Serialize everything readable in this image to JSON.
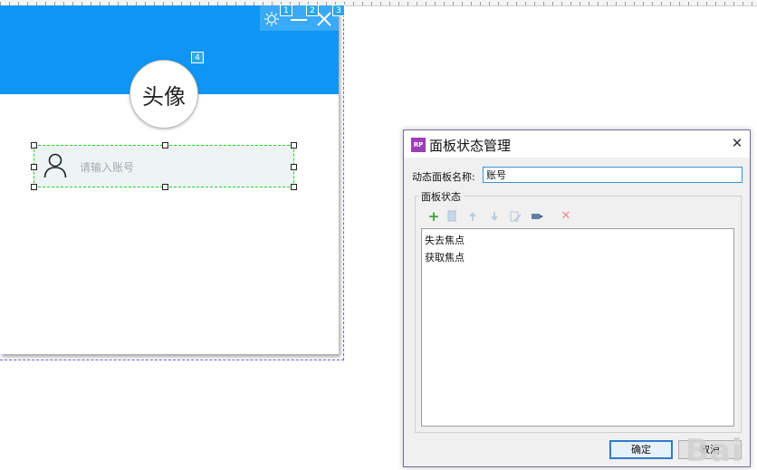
{
  "card": {
    "avatar_label": "头像",
    "input_placeholder": "请输入账号",
    "badges": [
      "1",
      "2",
      "3",
      "4"
    ]
  },
  "dialog": {
    "title": "面板状态管理",
    "name_label": "动态面板名称:",
    "name_value": "账号",
    "group_label": "面板状态",
    "states": [
      "失去焦点",
      "获取焦点"
    ],
    "ok_label": "确定",
    "cancel_label": "取消"
  },
  "colors": {
    "header_blue": "#0f96f5",
    "selection_green": "#1fd81f",
    "dialog_accent": "#2f7ad0"
  },
  "icons": [
    "gear-icon",
    "minimize-icon",
    "close-icon",
    "user-icon",
    "add-icon",
    "duplicate-icon",
    "move-up-icon",
    "move-down-icon",
    "edit-icon",
    "edit-all-icon",
    "delete-icon"
  ]
}
